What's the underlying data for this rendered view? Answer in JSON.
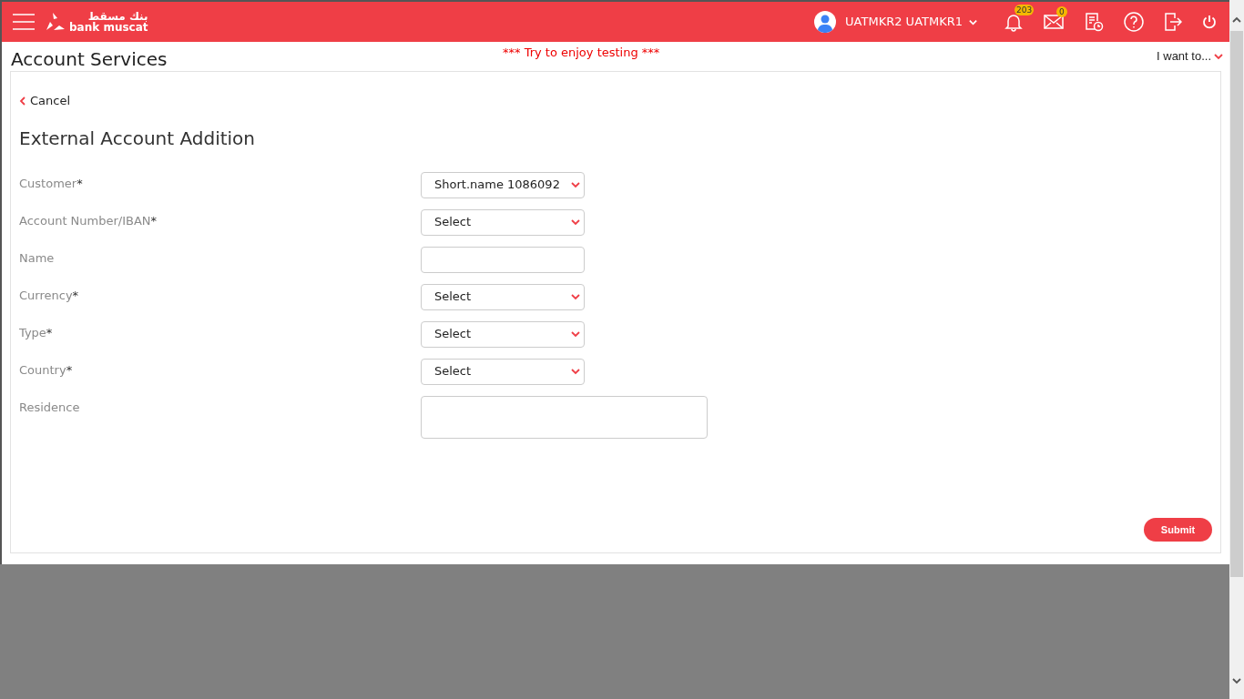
{
  "header": {
    "logo_arabic": "بنك مسقط",
    "logo_text": "bank muscat",
    "user": "UATMKR2 UATMKR1",
    "notifications_count": "203",
    "messages_count": "0"
  },
  "page": {
    "title": "Account Services",
    "banner": "*** Try to enjoy testing ***",
    "menu": "I want to..."
  },
  "form": {
    "back": "Cancel",
    "title": "External Account Addition",
    "fields": [
      {
        "label": "Customer",
        "required": "*",
        "kind": "select",
        "value": "Short.name 1086092"
      },
      {
        "label": "Account Number/IBAN",
        "required": "*",
        "kind": "select",
        "value": "Select"
      },
      {
        "label": "Name",
        "kind": "text"
      },
      {
        "label": "Currency",
        "required": "*",
        "kind": "select",
        "value": "Select"
      },
      {
        "label": "Type",
        "required": "*",
        "kind": "select",
        "value": "Select"
      },
      {
        "label": "Country",
        "required": "*",
        "kind": "select",
        "value": "Select"
      },
      {
        "label": "Residence",
        "kind": "textarea"
      }
    ],
    "submit": "Submit"
  }
}
